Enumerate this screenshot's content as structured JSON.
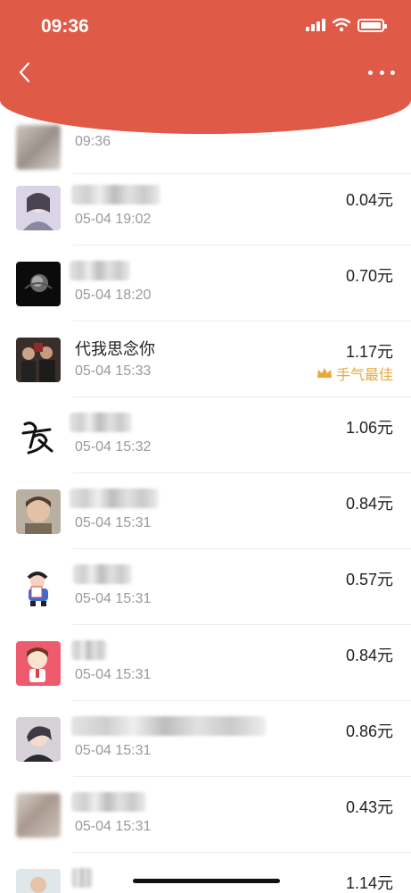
{
  "status_bar": {
    "time": "09:36"
  },
  "nav": {
    "back_icon": "chevron-left-icon",
    "more_icon": "more-dots-icon"
  },
  "list": [
    {
      "name": "",
      "time": "09:36",
      "amount": ""
    },
    {
      "name": "",
      "time": "05-04 19:02",
      "amount": "0.04元"
    },
    {
      "name": "",
      "time": "05-04 18:20",
      "amount": "0.70元"
    },
    {
      "name": "代我思念你",
      "time": "05-04 15:33",
      "amount": "1.17元",
      "best_label": "手气最佳"
    },
    {
      "name": "",
      "time": "05-04 15:32",
      "amount": "1.06元"
    },
    {
      "name": "",
      "time": "05-04 15:31",
      "amount": "0.84元"
    },
    {
      "name": "",
      "time": "05-04 15:31",
      "amount": "0.57元"
    },
    {
      "name": "",
      "time": "05-04 15:31",
      "amount": "0.84元"
    },
    {
      "name": "",
      "time": "05-04 15:31",
      "amount": "0.86元"
    },
    {
      "name": "",
      "time": "05-04 15:31",
      "amount": "0.43元"
    },
    {
      "name": "",
      "time": "",
      "amount": "1.14元"
    }
  ],
  "colors": {
    "header": "#e05a48",
    "best_gold": "#e8a93a",
    "muted": "#9a9a9a"
  }
}
